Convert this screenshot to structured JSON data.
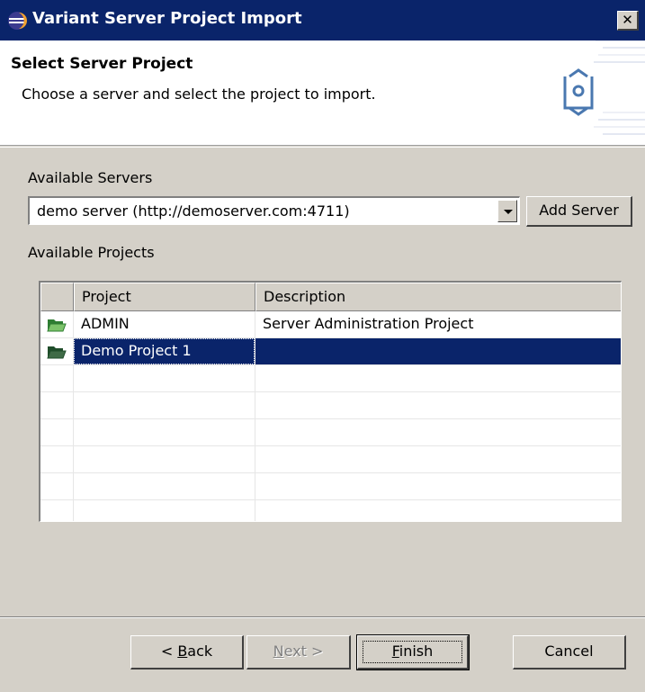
{
  "window": {
    "title": "Variant Server Project Import",
    "close_glyph": "✕"
  },
  "banner": {
    "title": "Select Server Project",
    "description": "Choose a server and select the project to import.",
    "icon": "import-project-icon"
  },
  "servers": {
    "label": "Available Servers",
    "selected": "demo server (http://demoserver.com:4711)",
    "add_button": "Add Server"
  },
  "projects": {
    "label": "Available Projects",
    "columns": [
      "Project",
      "Description"
    ],
    "rows": [
      {
        "icon": "folder-open-icon",
        "project": "ADMIN",
        "description": "Server Administration Project",
        "selected": false
      },
      {
        "icon": "folder-open-icon",
        "project": "Demo Project 1",
        "description": "",
        "selected": true
      }
    ]
  },
  "buttons": {
    "back_prefix": "< ",
    "back_key": "B",
    "back_rest": "ack",
    "next_key": "N",
    "next_rest": "ext >",
    "finish_key": "F",
    "finish_rest": "inish",
    "cancel": "Cancel"
  },
  "colors": {
    "titlebar": "#0a246a",
    "selection": "#0a246a",
    "dialog_bg": "#d4d0c8",
    "folder_green": "#2e8b3e"
  }
}
